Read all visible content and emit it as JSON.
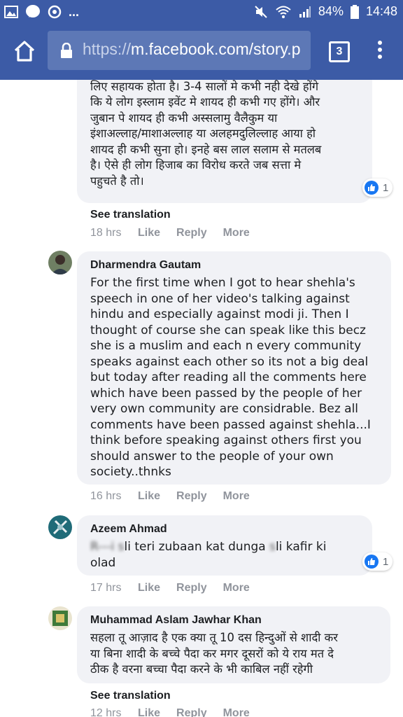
{
  "status_bar": {
    "battery": "84%",
    "time": "14:48",
    "icons": [
      "image-icon",
      "messenger-icon",
      "sync-icon",
      "more-dots",
      "mute-icon",
      "wifi-icon",
      "signal-icon",
      "battery-icon"
    ],
    "more": "..."
  },
  "browser": {
    "url_prefix": "https://",
    "url_main": "m.facebook.com/story.p",
    "tab_count": "3"
  },
  "comments": [
    {
      "name": "",
      "text": "का इस्लाम से कोई लेना देना नहीं होता बस उर्दू नाम इनके\nलिए सहायक होता है। 3-4 सालों मे कभी नही देखे होंगे\nकि ये लोग इस्लाम इवेंट मे शायद ही कभी गए होंगे। और\nजुबान पे शायद ही कभी अस्सलामु वैलैकुम या\nइंशाअल्लाह/माशाअल्लाह या अलहमदुलिल्लाह आया हो\nशायद ही कभी सुना हो। इनहे बस लाल सलाम से मतलब\nहै। ऐसे ही लोग हिजाब का विरोध करते जब सत्ता मे\nपहुचते है तो।",
      "reactions": "1",
      "see_translation": "See translation",
      "time": "18 hrs",
      "like": "Like",
      "reply": "Reply",
      "more": "More"
    },
    {
      "name": "Dharmendra Gautam",
      "text": "For the first time when I got to hear shehla's\nspeech in one of her video's talking against\nhindu and especially against modi ji. Then I\nthought of course she can speak like this becz\nshe is a muslim and each n every community\nspeaks against each other so its not a big deal\nbut today after reading all the comments here\nwhich have been passed by the people of her\nvery own community are considrable. Bez all\ncomments have been passed against shehla...I\nthink before speaking against others first you\nshould answer to the people of your own\nsociety..thnks",
      "time": "16 hrs",
      "like": "Like",
      "reply": "Reply",
      "more": "More"
    },
    {
      "name": "Azeem Ahmad",
      "text_blur1": "R---i s",
      "text_part1": "li teri zubaan kat dunga ",
      "text_blur2": "s",
      "text_part2": "li kafir ki\nolad",
      "reactions": "1",
      "time": "17 hrs",
      "like": "Like",
      "reply": "Reply",
      "more": "More"
    },
    {
      "name": "Muhammad Aslam Jawhar Khan",
      "text": "सहला तू आज़ाद है एक क्या तू 10 दस हिन्दुओं से शादी कर\nया बिना शादी के बच्चे पैदा कर मगर दूसरों को ये राय मत दे\nठीक है वरना बच्चा पैदा करने के भी काबिल नहीं रहेगी",
      "see_translation": "See translation",
      "time": "12 hrs",
      "like": "Like",
      "reply": "Reply",
      "more": "More"
    }
  ],
  "colors": {
    "header": "#3c5ba6",
    "bubble": "#f1f2f6",
    "meta": "#90949c",
    "like_blue": "#1877f2"
  }
}
